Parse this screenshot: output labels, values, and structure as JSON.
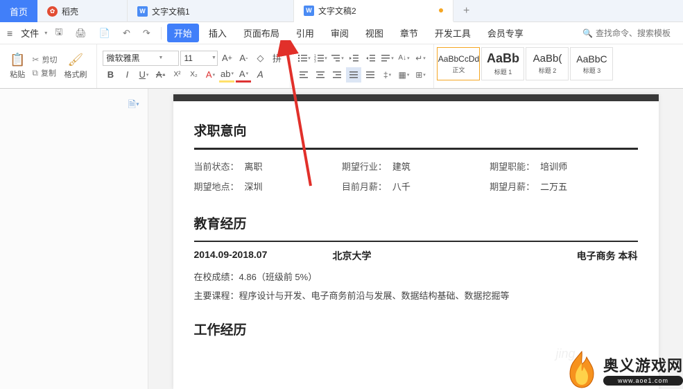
{
  "tabs": {
    "home": "首页",
    "daoke": "稻壳",
    "doc1": "文字文稿1",
    "doc2": "文字文稿2"
  },
  "menubar": {
    "file": "文件",
    "tabs": [
      "开始",
      "插入",
      "页面布局",
      "引用",
      "审阅",
      "视图",
      "章节",
      "开发工具",
      "会员专享"
    ],
    "search_ph": "查找命令、搜索模板"
  },
  "ribbon": {
    "paste": "粘贴",
    "cut": "剪切",
    "copy": "复制",
    "format": "格式刷",
    "font_name": "微软雅黑",
    "font_size": "11",
    "styles": [
      {
        "prev": "AaBbCcDd",
        "label": "正文"
      },
      {
        "prev": "AaBb",
        "label": "标题 1"
      },
      {
        "prev": "AaBb(",
        "label": "标题 2"
      },
      {
        "prev": "AaBbC",
        "label": "标题 3"
      }
    ]
  },
  "doc": {
    "sec1": "求职意向",
    "info": [
      {
        "l": "当前状态：",
        "v": "离职"
      },
      {
        "l": "期望行业：",
        "v": "建筑"
      },
      {
        "l": "期望职能：",
        "v": "培训师"
      },
      {
        "l": "期望地点：",
        "v": "深圳"
      },
      {
        "l": "目前月薪：",
        "v": "八千"
      },
      {
        "l": "期望月薪：",
        "v": "二万五"
      }
    ],
    "sec2": "教育经历",
    "edu": {
      "period": "2014.09-2018.07",
      "school": "北京大学",
      "major": "电子商务  本科",
      "line1_l": "在校成绩：",
      "line1_v": "4.86（班级前 5%）",
      "line2_l": "主要课程：",
      "line2_v": "程序设计与开发、电子商务前沿与发展、数据结构基础、数据挖掘等"
    },
    "sec3": "工作经历"
  },
  "watermark": {
    "title": "奥义游戏网",
    "url": "www.aoe1.com",
    "faded": "jing"
  }
}
